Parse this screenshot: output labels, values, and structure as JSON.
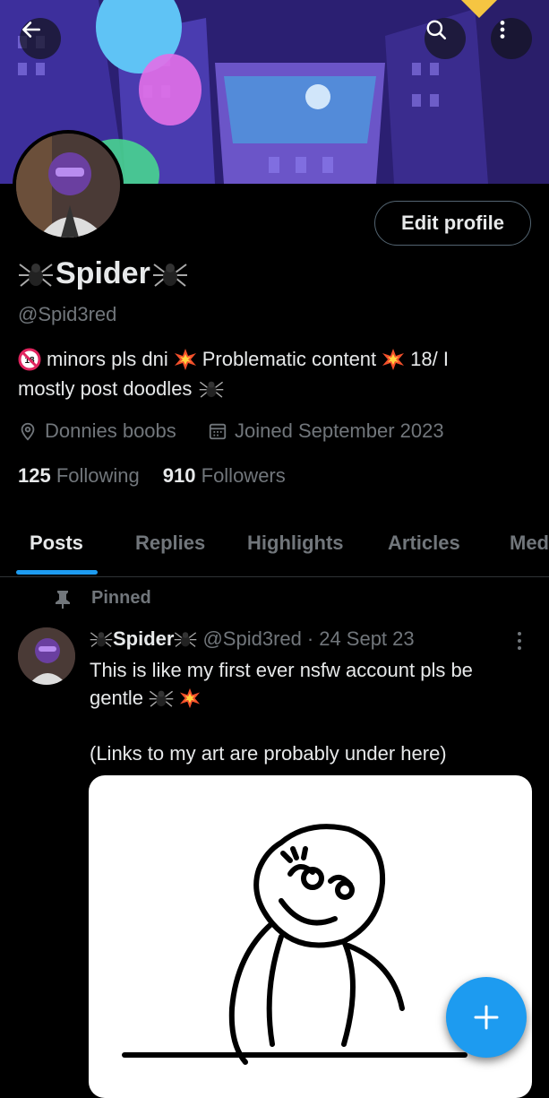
{
  "profile": {
    "name": "Spider",
    "handle": "@Spid3red",
    "bio_line1": "minors pls dni",
    "bio_line1b": "Problematic content",
    "bio_line1c": "18/ I",
    "bio_line2": "mostly post doodles",
    "location": "Donnies boobs",
    "joined": "Joined September 2023",
    "following_count": "125",
    "following_label": "Following",
    "followers_count": "910",
    "followers_label": "Followers",
    "edit_label": "Edit profile"
  },
  "tabs": [
    "Posts",
    "Replies",
    "Highlights",
    "Articles",
    "Med"
  ],
  "pinned_label": "Pinned",
  "post": {
    "name": "Spider",
    "handle": "@Spid3red",
    "dot": "·",
    "date": "24 Sept 23",
    "text_line1": "This is like my first ever nsfw account pls be",
    "text_line2": "gentle",
    "text_line3": "(Links to my art are probably under here)"
  },
  "colors": {
    "accent": "#1d9bf0",
    "background": "#000000",
    "muted": "#71767b",
    "text": "#e7e9ea"
  }
}
